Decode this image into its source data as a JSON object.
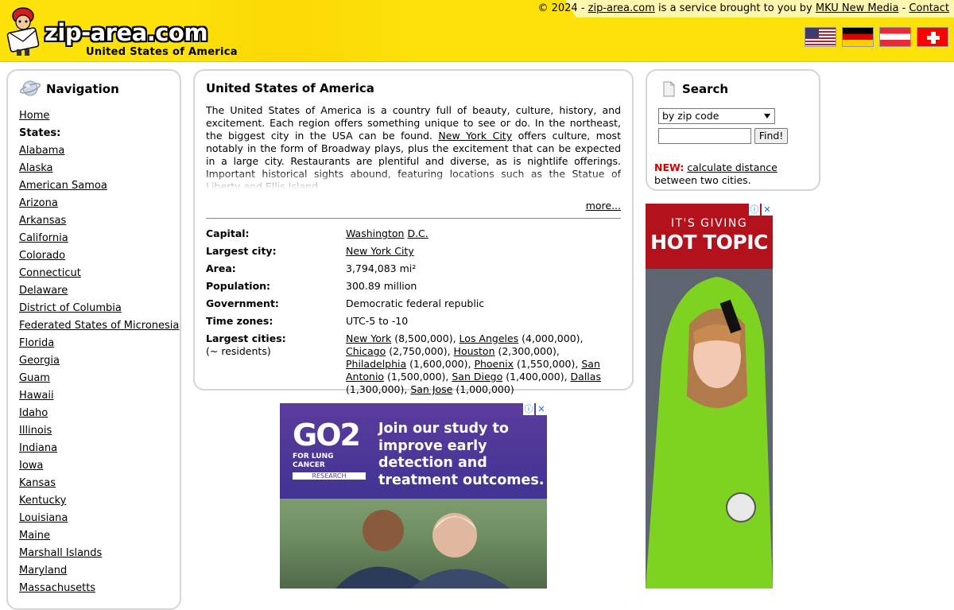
{
  "header": {
    "logo_text": "zip-area.com",
    "logo_subtitle": "United States of America",
    "copyright_prefix": "© 2024 - ",
    "copyright_site": "zip-area.com",
    "copyright_middle": " is a service brought to you by ",
    "copyright_company": "MKU New Media",
    "copyright_sep": " - ",
    "contact_label": "Contact",
    "flags": [
      "us-flag",
      "germany-flag",
      "austria-flag",
      "switzerland-flag"
    ]
  },
  "nav": {
    "title": "Navigation",
    "home_label": "Home",
    "states_heading": "States:",
    "states": [
      "Alabama",
      "Alaska",
      "American Samoa",
      "Arizona",
      "Arkansas",
      "California",
      "Colorado",
      "Connecticut",
      "Delaware",
      "District of Columbia",
      "Federated States of Micronesia",
      "Florida",
      "Georgia",
      "Guam",
      "Hawaii",
      "Idaho",
      "Illinois",
      "Indiana",
      "Iowa",
      "Kansas",
      "Kentucky",
      "Louisiana",
      "Maine",
      "Marshall Islands",
      "Maryland",
      "Massachusetts"
    ]
  },
  "main": {
    "title": "United States of America",
    "desc_part1": "The United States of America is a country full of beauty, culture, history, and excitement. Each region offers something unique to see or do. In the northeast, the biggest city in the USA can be found. ",
    "desc_link": "New York City",
    "desc_part2": " offers culture, most notably in the form of Broadway plays, plus the excitement that can be expected in a large city. Restaurants are plentiful and diverse, as is nightlife offerings. Important historical sights abound, featuring locations such as the Statue of Liberty and Ellis Island.",
    "more_label": "more...",
    "facts": {
      "capital_label": "Capital:",
      "capital_city": "Washington",
      "capital_dc": "D.C.",
      "largest_city_label": "Largest city:",
      "largest_city": "New York City",
      "area_label": "Area:",
      "area": "3,794,083 mi²",
      "population_label": "Population:",
      "population": "300.89 million",
      "government_label": "Government:",
      "government": "Democratic federal republic",
      "timezones_label": "Time zones:",
      "timezones": "UTC-5 to -10",
      "largest_cities_label": "Largest cities:",
      "largest_cities_sub": "(~ residents)",
      "cities": [
        {
          "name": "New York",
          "pop": " (8,500,000), "
        },
        {
          "name": "Los Angeles",
          "pop": " (4,000,000), "
        },
        {
          "name": "Chicago",
          "pop": " (2,750,000), "
        },
        {
          "name": "Houston",
          "pop": " (2,300,000), "
        },
        {
          "name": "Philadelphia",
          "pop": " (1,600,000), "
        },
        {
          "name": "Phoenix",
          "pop": " (1,550,000), "
        },
        {
          "name": "San Antonio",
          "pop": " (1,500,000), "
        },
        {
          "name": "San Diego",
          "pop": " (1,400,000), "
        },
        {
          "name": "Dallas",
          "pop": " (1,300,000), "
        },
        {
          "name": "San Jose",
          "pop": " (1,000,000)"
        }
      ]
    }
  },
  "search": {
    "title": "Search",
    "select_value": "by zip code",
    "input_value": "",
    "button_label": "Find!",
    "new_label": "NEW:",
    "new_link": "calculate distance",
    "new_suffix": " between two cities."
  },
  "ad1": {
    "logo_big": "GO2",
    "logo_small": "FOR LUNG CANCER",
    "logo_tag": "RESEARCH",
    "text": "Join our study to improve early detection and treatment outcomes."
  },
  "ad2": {
    "line1": "IT'S GIVING",
    "line2": "HOT TOPIC"
  },
  "colors": {
    "header_yellow": "#fde20a",
    "new_red": "#d00000",
    "panel_border": "#d5d5d5"
  }
}
